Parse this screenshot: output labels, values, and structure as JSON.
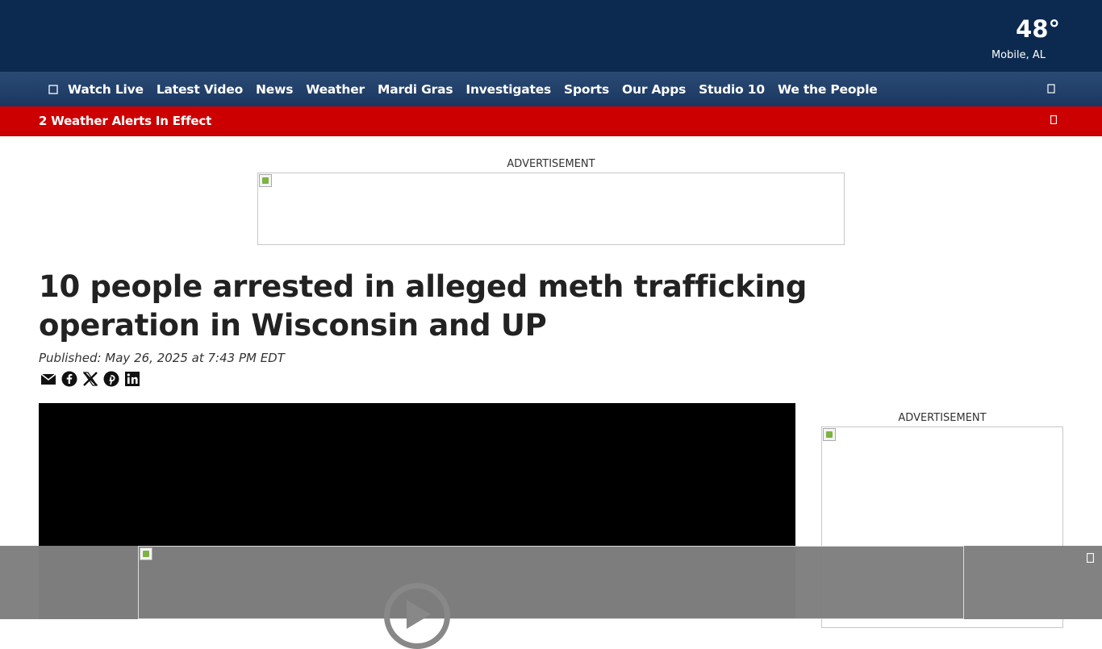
{
  "weather": {
    "temp": "48°",
    "location": "Mobile, AL"
  },
  "nav": {
    "menu_icon": "menu-icon",
    "items": [
      "Watch Live",
      "Latest Video",
      "News",
      "Weather",
      "Mardi Gras",
      "Investigates",
      "Sports",
      "Our Apps",
      "Studio 10",
      "We the People"
    ],
    "search_icon": "search-icon"
  },
  "alert": {
    "text": "2 Weather Alerts In Effect",
    "icon": "chevron-down-icon"
  },
  "ads": {
    "top_label": "ADVERTISEMENT",
    "side_label": "ADVERTISEMENT"
  },
  "article": {
    "headline": "10 people arrested in alleged meth trafficking operation in Wisconsin and UP",
    "published": "Published: May 26, 2025 at 7:43 PM EDT"
  },
  "share": [
    "email-icon",
    "facebook-icon",
    "x-icon",
    "pinterest-icon",
    "linkedin-icon"
  ],
  "colors": {
    "header_bg": "#0c2a4f",
    "nav_bg": "#1f3d66",
    "alert_bg": "#cc0000"
  }
}
